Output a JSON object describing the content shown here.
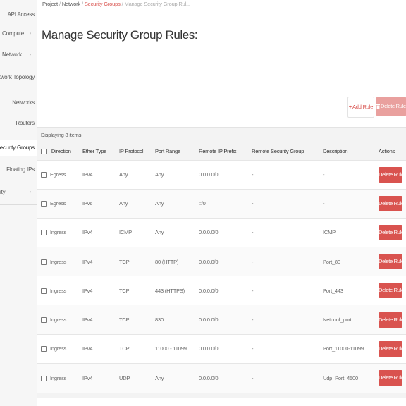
{
  "sidebar": {
    "items": [
      {
        "label": "API Access",
        "align": "right"
      },
      {
        "label": "Compute",
        "align": "left",
        "chevron": "›"
      },
      {
        "label": "Network",
        "align": "left",
        "chevron": "›"
      },
      {
        "label": "Network Topology",
        "align": "right"
      },
      {
        "label": "Networks",
        "align": "right"
      },
      {
        "label": "Routers",
        "align": "right"
      },
      {
        "label": "Security Groups",
        "align": "right",
        "active": true
      },
      {
        "label": "Floating IPs",
        "align": "right"
      },
      {
        "label": "ity",
        "align": "left",
        "chevron": "›"
      }
    ]
  },
  "breadcrumb": {
    "project": "Project",
    "network": "Network",
    "security_groups": "Security Groups",
    "current": "Manage Security Group Rul..."
  },
  "page": {
    "title": "Manage Security Group Rules:"
  },
  "toolbar": {
    "add_rule": "Add Rule",
    "delete_rules": "Delete Rules",
    "add_icon": "plus-icon",
    "delete_icon": "trash-icon"
  },
  "table": {
    "count_label": "Displaying 8 items",
    "columns": [
      "Direction",
      "Ether Type",
      "IP Protocol",
      "Port Range",
      "Remote IP Prefix",
      "Remote Security Group",
      "Description",
      "Actions"
    ],
    "delete_label": "Delete Rule",
    "rows": [
      {
        "direction": "Egress",
        "ether": "IPv4",
        "protocol": "Any",
        "port": "Any",
        "prefix": "0.0.0.0/0",
        "group": "-",
        "description": "-"
      },
      {
        "direction": "Egress",
        "ether": "IPv6",
        "protocol": "Any",
        "port": "Any",
        "prefix": "::/0",
        "group": "-",
        "description": "-"
      },
      {
        "direction": "Ingress",
        "ether": "IPv4",
        "protocol": "ICMP",
        "port": "Any",
        "prefix": "0.0.0.0/0",
        "group": "-",
        "description": "ICMP"
      },
      {
        "direction": "Ingress",
        "ether": "IPv4",
        "protocol": "TCP",
        "port": "80 (HTTP)",
        "prefix": "0.0.0.0/0",
        "group": "-",
        "description": "Port_80"
      },
      {
        "direction": "Ingress",
        "ether": "IPv4",
        "protocol": "TCP",
        "port": "443 (HTTPS)",
        "prefix": "0.0.0.0/0",
        "group": "-",
        "description": "Port_443"
      },
      {
        "direction": "Ingress",
        "ether": "IPv4",
        "protocol": "TCP",
        "port": "830",
        "prefix": "0.0.0.0/0",
        "group": "-",
        "description": "Netconf_port"
      },
      {
        "direction": "Ingress",
        "ether": "IPv4",
        "protocol": "TCP",
        "port": "11000 - 11099",
        "prefix": "0.0.0.0/0",
        "group": "-",
        "description": "Port_11000-11099"
      },
      {
        "direction": "Ingress",
        "ether": "IPv4",
        "protocol": "UDP",
        "port": "Any",
        "prefix": "0.0.0.0/0",
        "group": "-",
        "description": "Udp_Port_4500"
      }
    ]
  },
  "colors": {
    "accent": "#d9534f",
    "accent_light": "#e9a09e",
    "sidebar_bg": "#f6f6f6"
  }
}
